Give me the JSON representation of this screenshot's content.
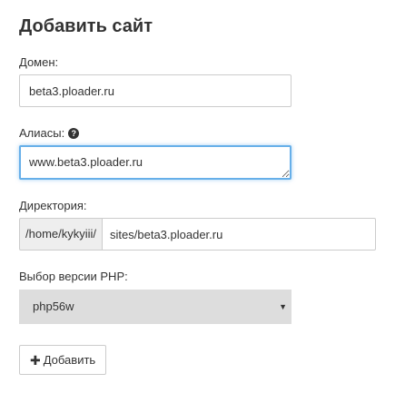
{
  "page": {
    "title": "Добавить сайт"
  },
  "domain": {
    "label": "Домен:",
    "value": "beta3.ploader.ru"
  },
  "aliases": {
    "label": "Алиасы:",
    "help_icon": "question-circle-icon",
    "value": "www.beta3.ploader.ru"
  },
  "directory": {
    "label": "Директория:",
    "prefix": "/home/kykyiii/",
    "value": "sites/beta3.ploader.ru"
  },
  "php": {
    "label": "Выбор версии PHP:",
    "selected": "php56w",
    "arrow_icon": "caret-down-icon"
  },
  "submit": {
    "icon": "plus-icon",
    "label": "Добавить"
  },
  "colors": {
    "focus_border": "#66afe9",
    "select_bg": "#dddddd",
    "addon_bg": "#eeeeee"
  }
}
